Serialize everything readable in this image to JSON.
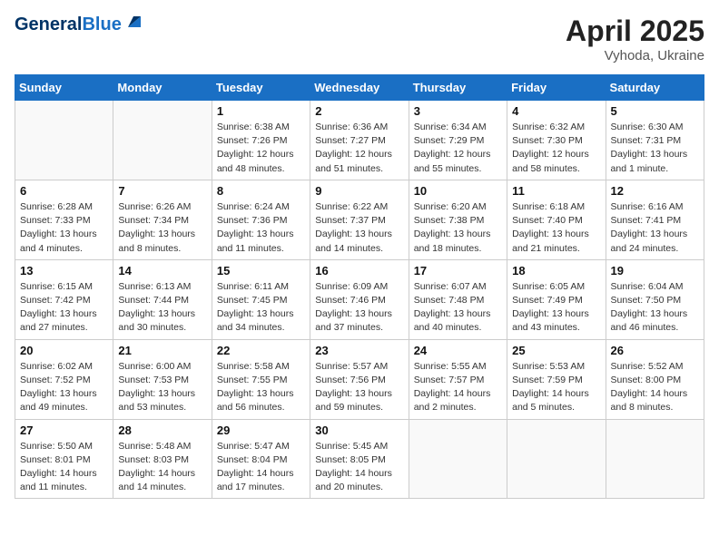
{
  "header": {
    "logo_line1": "General",
    "logo_line2": "Blue",
    "month_title": "April 2025",
    "location": "Vyhoda, Ukraine"
  },
  "weekdays": [
    "Sunday",
    "Monday",
    "Tuesday",
    "Wednesday",
    "Thursday",
    "Friday",
    "Saturday"
  ],
  "weeks": [
    [
      null,
      null,
      {
        "day": 1,
        "sunrise": "Sunrise: 6:38 AM",
        "sunset": "Sunset: 7:26 PM",
        "daylight": "Daylight: 12 hours and 48 minutes."
      },
      {
        "day": 2,
        "sunrise": "Sunrise: 6:36 AM",
        "sunset": "Sunset: 7:27 PM",
        "daylight": "Daylight: 12 hours and 51 minutes."
      },
      {
        "day": 3,
        "sunrise": "Sunrise: 6:34 AM",
        "sunset": "Sunset: 7:29 PM",
        "daylight": "Daylight: 12 hours and 55 minutes."
      },
      {
        "day": 4,
        "sunrise": "Sunrise: 6:32 AM",
        "sunset": "Sunset: 7:30 PM",
        "daylight": "Daylight: 12 hours and 58 minutes."
      },
      {
        "day": 5,
        "sunrise": "Sunrise: 6:30 AM",
        "sunset": "Sunset: 7:31 PM",
        "daylight": "Daylight: 13 hours and 1 minute."
      }
    ],
    [
      {
        "day": 6,
        "sunrise": "Sunrise: 6:28 AM",
        "sunset": "Sunset: 7:33 PM",
        "daylight": "Daylight: 13 hours and 4 minutes."
      },
      {
        "day": 7,
        "sunrise": "Sunrise: 6:26 AM",
        "sunset": "Sunset: 7:34 PM",
        "daylight": "Daylight: 13 hours and 8 minutes."
      },
      {
        "day": 8,
        "sunrise": "Sunrise: 6:24 AM",
        "sunset": "Sunset: 7:36 PM",
        "daylight": "Daylight: 13 hours and 11 minutes."
      },
      {
        "day": 9,
        "sunrise": "Sunrise: 6:22 AM",
        "sunset": "Sunset: 7:37 PM",
        "daylight": "Daylight: 13 hours and 14 minutes."
      },
      {
        "day": 10,
        "sunrise": "Sunrise: 6:20 AM",
        "sunset": "Sunset: 7:38 PM",
        "daylight": "Daylight: 13 hours and 18 minutes."
      },
      {
        "day": 11,
        "sunrise": "Sunrise: 6:18 AM",
        "sunset": "Sunset: 7:40 PM",
        "daylight": "Daylight: 13 hours and 21 minutes."
      },
      {
        "day": 12,
        "sunrise": "Sunrise: 6:16 AM",
        "sunset": "Sunset: 7:41 PM",
        "daylight": "Daylight: 13 hours and 24 minutes."
      }
    ],
    [
      {
        "day": 13,
        "sunrise": "Sunrise: 6:15 AM",
        "sunset": "Sunset: 7:42 PM",
        "daylight": "Daylight: 13 hours and 27 minutes."
      },
      {
        "day": 14,
        "sunrise": "Sunrise: 6:13 AM",
        "sunset": "Sunset: 7:44 PM",
        "daylight": "Daylight: 13 hours and 30 minutes."
      },
      {
        "day": 15,
        "sunrise": "Sunrise: 6:11 AM",
        "sunset": "Sunset: 7:45 PM",
        "daylight": "Daylight: 13 hours and 34 minutes."
      },
      {
        "day": 16,
        "sunrise": "Sunrise: 6:09 AM",
        "sunset": "Sunset: 7:46 PM",
        "daylight": "Daylight: 13 hours and 37 minutes."
      },
      {
        "day": 17,
        "sunrise": "Sunrise: 6:07 AM",
        "sunset": "Sunset: 7:48 PM",
        "daylight": "Daylight: 13 hours and 40 minutes."
      },
      {
        "day": 18,
        "sunrise": "Sunrise: 6:05 AM",
        "sunset": "Sunset: 7:49 PM",
        "daylight": "Daylight: 13 hours and 43 minutes."
      },
      {
        "day": 19,
        "sunrise": "Sunrise: 6:04 AM",
        "sunset": "Sunset: 7:50 PM",
        "daylight": "Daylight: 13 hours and 46 minutes."
      }
    ],
    [
      {
        "day": 20,
        "sunrise": "Sunrise: 6:02 AM",
        "sunset": "Sunset: 7:52 PM",
        "daylight": "Daylight: 13 hours and 49 minutes."
      },
      {
        "day": 21,
        "sunrise": "Sunrise: 6:00 AM",
        "sunset": "Sunset: 7:53 PM",
        "daylight": "Daylight: 13 hours and 53 minutes."
      },
      {
        "day": 22,
        "sunrise": "Sunrise: 5:58 AM",
        "sunset": "Sunset: 7:55 PM",
        "daylight": "Daylight: 13 hours and 56 minutes."
      },
      {
        "day": 23,
        "sunrise": "Sunrise: 5:57 AM",
        "sunset": "Sunset: 7:56 PM",
        "daylight": "Daylight: 13 hours and 59 minutes."
      },
      {
        "day": 24,
        "sunrise": "Sunrise: 5:55 AM",
        "sunset": "Sunset: 7:57 PM",
        "daylight": "Daylight: 14 hours and 2 minutes."
      },
      {
        "day": 25,
        "sunrise": "Sunrise: 5:53 AM",
        "sunset": "Sunset: 7:59 PM",
        "daylight": "Daylight: 14 hours and 5 minutes."
      },
      {
        "day": 26,
        "sunrise": "Sunrise: 5:52 AM",
        "sunset": "Sunset: 8:00 PM",
        "daylight": "Daylight: 14 hours and 8 minutes."
      }
    ],
    [
      {
        "day": 27,
        "sunrise": "Sunrise: 5:50 AM",
        "sunset": "Sunset: 8:01 PM",
        "daylight": "Daylight: 14 hours and 11 minutes."
      },
      {
        "day": 28,
        "sunrise": "Sunrise: 5:48 AM",
        "sunset": "Sunset: 8:03 PM",
        "daylight": "Daylight: 14 hours and 14 minutes."
      },
      {
        "day": 29,
        "sunrise": "Sunrise: 5:47 AM",
        "sunset": "Sunset: 8:04 PM",
        "daylight": "Daylight: 14 hours and 17 minutes."
      },
      {
        "day": 30,
        "sunrise": "Sunrise: 5:45 AM",
        "sunset": "Sunset: 8:05 PM",
        "daylight": "Daylight: 14 hours and 20 minutes."
      },
      null,
      null,
      null
    ]
  ]
}
